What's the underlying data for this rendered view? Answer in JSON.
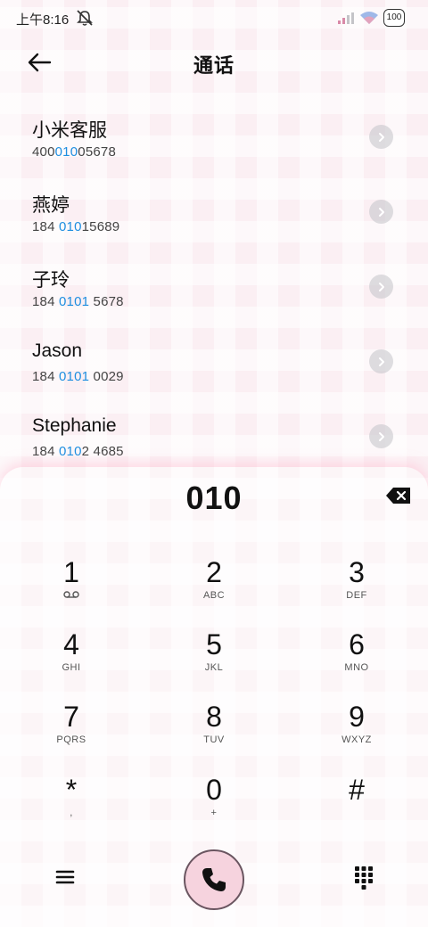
{
  "status_bar": {
    "time": "上午8:16",
    "battery": "100",
    "icons": [
      "mute-icon",
      "signal-icon",
      "wifi-icon",
      "battery-icon"
    ]
  },
  "header": {
    "title": "通话",
    "back_icon": "arrow-left-icon"
  },
  "contacts": [
    {
      "name": "小米客服",
      "number_pre": "400",
      "number_hl": "010",
      "number_post": "05678"
    },
    {
      "name": "燕婷",
      "number_pre": "184 ",
      "number_hl": "010",
      "number_post": "15689"
    },
    {
      "name": "子玲",
      "number_pre": "184 ",
      "number_hl": "0101",
      "number_post": " 5678"
    },
    {
      "name": "Jason",
      "number_pre": "184 ",
      "number_hl": "0101",
      "number_post": " 0029"
    },
    {
      "name": "Stephanie",
      "number_pre": "184 ",
      "number_hl": "010",
      "number_post": "2 4685"
    }
  ],
  "dialer": {
    "input": "010",
    "keys": [
      {
        "digit": "1",
        "sub": "voicemail-icon"
      },
      {
        "digit": "2",
        "sub": "ABC"
      },
      {
        "digit": "3",
        "sub": "DEF"
      },
      {
        "digit": "4",
        "sub": "GHI"
      },
      {
        "digit": "5",
        "sub": "JKL"
      },
      {
        "digit": "6",
        "sub": "MNO"
      },
      {
        "digit": "7",
        "sub": "PQRS"
      },
      {
        "digit": "8",
        "sub": "TUV"
      },
      {
        "digit": "9",
        "sub": "WXYZ"
      },
      {
        "digit": "*",
        "sub": ","
      },
      {
        "digit": "0",
        "sub": "+"
      },
      {
        "digit": "#",
        "sub": ""
      }
    ]
  },
  "bottom_bar": {
    "icons": [
      "menu-icon",
      "phone-icon",
      "dialpad-icon"
    ]
  },
  "colors": {
    "highlight": "#1e8ee0",
    "call_button": "#f6d3de",
    "background": "#fbeff3"
  }
}
